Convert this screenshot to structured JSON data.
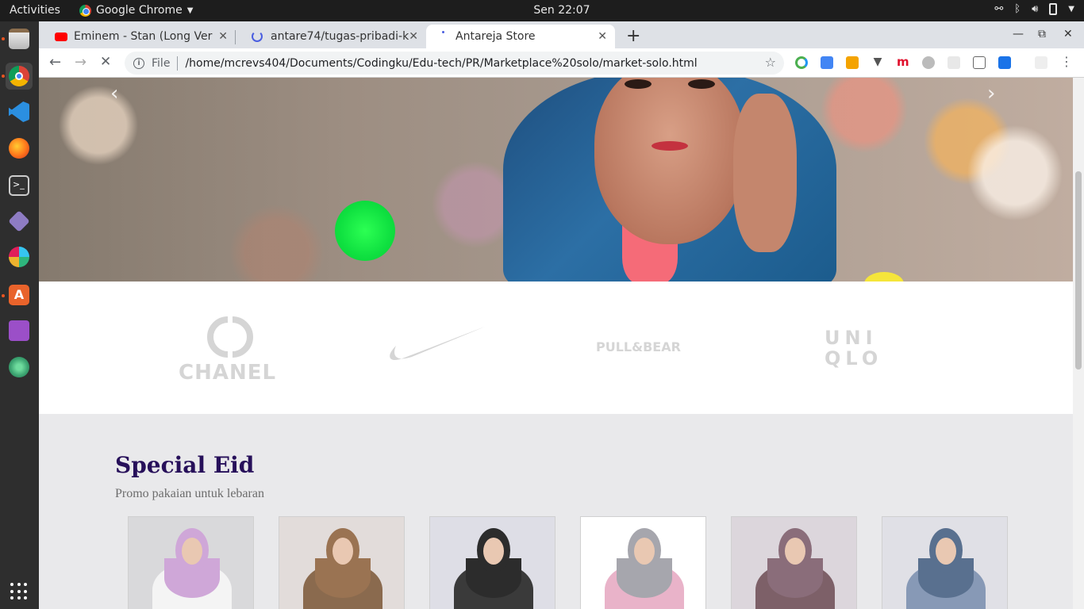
{
  "topbar": {
    "activities": "Activities",
    "app_name": "Google Chrome",
    "clock": "Sen 22:07"
  },
  "tabs": [
    {
      "title": "Eminem - Stan (Long Vers",
      "icon": "youtube-icon",
      "active": false
    },
    {
      "title": "antare74/tugas-pribadi-k",
      "icon": "loading-spinner-icon",
      "active": false
    },
    {
      "title": "Antareja Store",
      "icon": "loading-dot-icon",
      "active": true
    }
  ],
  "toolbar": {
    "scheme_label": "File",
    "url": "/home/mcrevs404/Documents/Codingku/Edu-tech/PR/Marketplace%20solo/market-solo.html"
  },
  "carousel": {
    "prev_glyph": "‹",
    "next_glyph": "›"
  },
  "brands": [
    "CHANEL",
    "PULL&BEAR",
    "UNI",
    "QLO"
  ],
  "special": {
    "title": "Special Eid",
    "subtitle": "Promo pakaian untuk lebaran",
    "products": [
      {
        "hijab_color": "#cfa7d8",
        "body_color": "#f4f4f4",
        "bg": "#d9d9db"
      },
      {
        "hijab_color": "#9a7352",
        "body_color": "#8a6a4e",
        "bg": "#e2dcda"
      },
      {
        "hijab_color": "#2c2c2c",
        "body_color": "#3a3a3a",
        "bg": "#dedee6"
      },
      {
        "hijab_color": "#a6a6ad",
        "body_color": "#e9b3c9",
        "bg": "#ffffff"
      },
      {
        "hijab_color": "#8a6d7a",
        "body_color": "#7d6068",
        "bg": "#dcd6dc"
      },
      {
        "hijab_color": "#59708f",
        "body_color": "#8799b6",
        "bg": "#e0e0e6"
      }
    ]
  }
}
